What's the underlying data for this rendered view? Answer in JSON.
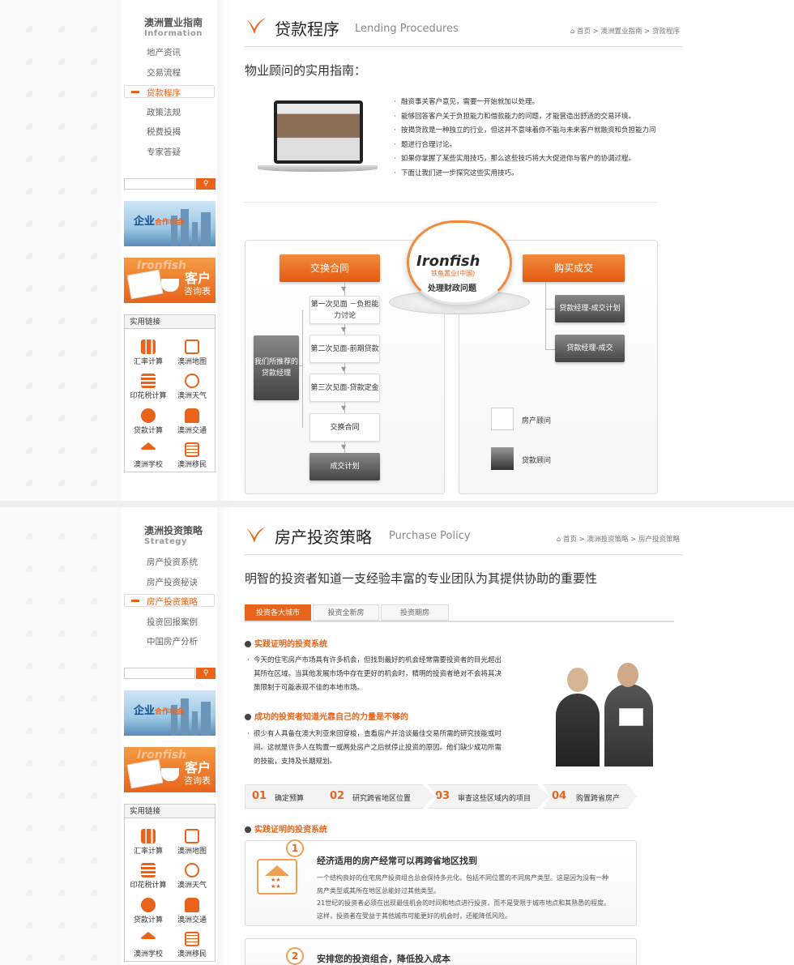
{
  "panel1": {
    "sidebar": {
      "title": "澳洲置业指南",
      "subtitle": "Information",
      "nav": [
        "地产资讯",
        "交易流程",
        "贷款程序",
        "政策法规",
        "税费投揭",
        "专家答疑"
      ],
      "active": "贷款程序"
    },
    "header": {
      "title": "贷款程序",
      "title_en": "Lending Procedures",
      "breadcrumb": "首页  >  澳洲置业指南  >  贷款程序"
    },
    "subheading": "物业顾问的实用指南：",
    "bullets": [
      "融资事关客户意见，需要一开始就加以处理。",
      "能够回答客户关于负担能力和借款能力的问题，才能营造出舒适的交易环境。",
      "按揭贷款是一种独立的行业，但这并不意味着你不能与未来客户就融资和负担能力问",
      "题进行合理讨论。",
      "如果你掌握了某些实用技巧，那么这些技巧将大大促进你与客户的协调过程。",
      "下面让我们进一步探究这些实用技巧。"
    ],
    "flow": {
      "left_title": "交换合同",
      "right_title": "购买成交",
      "center_logo": "Ironfish",
      "center_cn": "铁鱼置业(中国)",
      "center_text": "处理财政问题",
      "recommended": "我们所推荐的贷款经理",
      "steps": [
        "第一次见面 －负担能力讨论",
        "第二次见面-前期贷款",
        "第三次见面-贷款定金",
        "交换合同",
        "成交计划"
      ],
      "right_steps": [
        "贷款经理-成交计划",
        "贷款经理-成交"
      ],
      "legend": [
        "房产顾问",
        "贷款顾问"
      ]
    }
  },
  "panel2": {
    "sidebar": {
      "title": "澳洲投资策略",
      "subtitle": "Strategy",
      "nav": [
        "房产投资系统",
        "房产投资秘诀",
        "房产投资策略",
        "投资回报案例",
        "中国房产分析"
      ],
      "active": "房产投资策略"
    },
    "header": {
      "title": "房产投资策略",
      "title_en": "Purchase Policy",
      "breadcrumb": "首页  >  澳洲投资策略  >  房产投资策略"
    },
    "subheading": "明智的投资者知道一支经验丰富的专业团队为其提供协助的重要性",
    "tabs": [
      "投资各大城市",
      "投资全新房",
      "投资期房"
    ],
    "section1": {
      "title": "实践证明的投资系统",
      "text": [
        "今天的住宅房产市场具有许多机会，但找到最好的机会经常需要投资者的目光超出",
        "其所在区域。当其他发展市场中存在更好的机会时，精明的投资者绝对不会将其决",
        "策限制于可能表现不佳的本地市场。"
      ]
    },
    "section2": {
      "title": "成功的投资者知道光靠自己的力量是不够的",
      "text": [
        "很少有人具备在澳大利亚来回穿梭，查看房产并洽谈最佳交易所需的研究技能或时",
        "间。这就是许多人在购置一或两处房产之后就停止投资的原因。他们缺少成功所需",
        "的技能，支持及长期规划。"
      ]
    },
    "steps": [
      {
        "num": "01",
        "label": "确定预算"
      },
      {
        "num": "02",
        "label": "研究跨省地区位置"
      },
      {
        "num": "03",
        "label": "审查这些区域内的项目"
      },
      {
        "num": "04",
        "label": "购置跨省房产"
      }
    ],
    "section3": {
      "title": "实践证明的投资系统"
    },
    "cards": [
      {
        "num": "1",
        "title": "经济适用的房产经常可以再跨省地区找到",
        "text": [
          "一个结构良好的住宅房产投资组合总会保持多元化，包括不同位置的不同房产类型。这是因为没有一种",
          "房产类型或其所在地区总能好过其他类型。",
          "21世纪的投资者必须在出现最佳机会的时间和地点进行投资，而不是受限于城市地点和其熟悉的程度。",
          "这样，投资者在受益于其他城市可能更好的机会时，还能降低风险。"
        ]
      },
      {
        "num": "2",
        "title": "安排您的投资组合，降低投入成本"
      }
    ]
  },
  "shared": {
    "banner_biz": "企业",
    "banner_biz_small": "合作机会",
    "banner_cust_logo": "Ironfish",
    "banner_cust_1": "客户",
    "banner_cust_2": "咨询表",
    "links_title": "实用链接",
    "links": [
      "汇率计算",
      "澳洲地图",
      "印花税计算",
      "澳洲天气",
      "贷款计算",
      "澳洲交通",
      "澳洲学校",
      "澳洲移民"
    ],
    "search_btn": "⚲"
  },
  "colors": {
    "accent": "#e8641b",
    "gray_dark": "#444444"
  }
}
